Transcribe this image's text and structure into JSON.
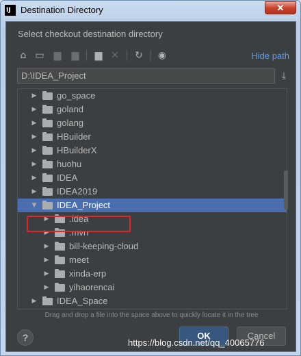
{
  "window": {
    "title": "Destination Directory",
    "app_icon_text": "IJ",
    "close_glyph": "✕"
  },
  "dialog": {
    "subtitle": "Select checkout destination directory",
    "hide_path_label": "Hide path",
    "path_value": "D:\\IDEA_Project",
    "hint": "Drag and drop a file into the space above to quickly locate it in the tree",
    "help_label": "?",
    "ok_label": "OK",
    "cancel_label": "Cancel"
  },
  "toolbar": {
    "icons": [
      "home-icon",
      "desktop-icon",
      "project-icon",
      "module-icon",
      "new-folder-icon",
      "delete-icon",
      "refresh-icon",
      "show-hidden-icon"
    ]
  },
  "tree": {
    "rows": [
      {
        "label": "go_space",
        "level": 1,
        "expanded": false,
        "selected": false
      },
      {
        "label": "goland",
        "level": 1,
        "expanded": false,
        "selected": false
      },
      {
        "label": "golang",
        "level": 1,
        "expanded": false,
        "selected": false
      },
      {
        "label": "HBuilder",
        "level": 1,
        "expanded": false,
        "selected": false
      },
      {
        "label": "HBuilderX",
        "level": 1,
        "expanded": false,
        "selected": false
      },
      {
        "label": "huohu",
        "level": 1,
        "expanded": false,
        "selected": false
      },
      {
        "label": "IDEA",
        "level": 1,
        "expanded": false,
        "selected": false
      },
      {
        "label": "IDEA2019",
        "level": 1,
        "expanded": false,
        "selected": false
      },
      {
        "label": "IDEA_Project",
        "level": 1,
        "expanded": true,
        "selected": true
      },
      {
        "label": ".idea",
        "level": 2,
        "expanded": false,
        "selected": false
      },
      {
        "label": ".mvn",
        "level": 2,
        "expanded": false,
        "selected": false
      },
      {
        "label": "bill-keeping-cloud",
        "level": 2,
        "expanded": false,
        "selected": false
      },
      {
        "label": "meet",
        "level": 2,
        "expanded": false,
        "selected": false
      },
      {
        "label": "xinda-erp",
        "level": 2,
        "expanded": false,
        "selected": false
      },
      {
        "label": "yihaorencai",
        "level": 2,
        "expanded": false,
        "selected": false
      },
      {
        "label": "IDEA_Space",
        "level": 1,
        "expanded": false,
        "selected": false
      }
    ]
  },
  "watermark": "https://blog.csdn.net/qq_40065776",
  "colors": {
    "background": "#3c3f41",
    "selection": "#4b6eaf",
    "link": "#589df6",
    "highlight_box": "#e0262b",
    "ok_button": "#365880"
  }
}
